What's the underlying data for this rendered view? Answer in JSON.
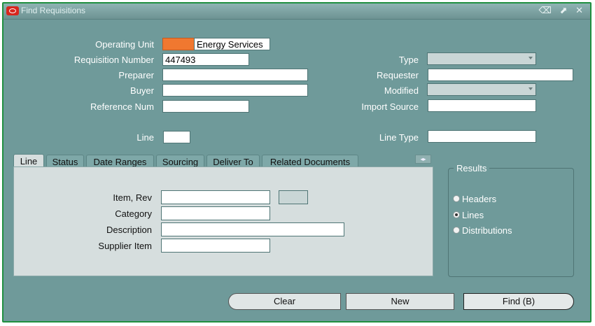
{
  "window": {
    "title": "Find Requisitions",
    "controls": [
      "⌫",
      "⬈",
      "✕"
    ]
  },
  "form": {
    "operating_unit_label": "Operating Unit",
    "operating_unit_value": "Energy Services",
    "requisition_number_label": "Requisition Number",
    "requisition_number_value": "447493",
    "preparer_label": "Preparer",
    "buyer_label": "Buyer",
    "reference_num_label": "Reference Num",
    "line_label": "Line",
    "type_label": "Type",
    "requester_label": "Requester",
    "modified_label": "Modified",
    "import_source_label": "Import Source",
    "line_type_label": "Line Type"
  },
  "tabs": [
    {
      "label": "Line"
    },
    {
      "label": "Status"
    },
    {
      "label": "Date Ranges"
    },
    {
      "label": "Sourcing"
    },
    {
      "label": "Deliver To"
    },
    {
      "label": "Related Documents"
    }
  ],
  "tab_scroll": "◂▸",
  "line_panel": {
    "item_rev_label": "Item, Rev",
    "category_label": "Category",
    "description_label": "Description",
    "supplier_item_label": "Supplier Item"
  },
  "results": {
    "legend": "Results",
    "options": [
      {
        "label": "Headers",
        "checked": false
      },
      {
        "label": "Lines",
        "checked": true
      },
      {
        "label": "Distributions",
        "checked": false
      }
    ]
  },
  "buttons": {
    "clear": "Clear",
    "new": "New",
    "find": "Find (B)"
  },
  "colors": {
    "window_bg": "#6f9a9a",
    "border": "#1f8f3f",
    "orange_field": "#f07830"
  }
}
